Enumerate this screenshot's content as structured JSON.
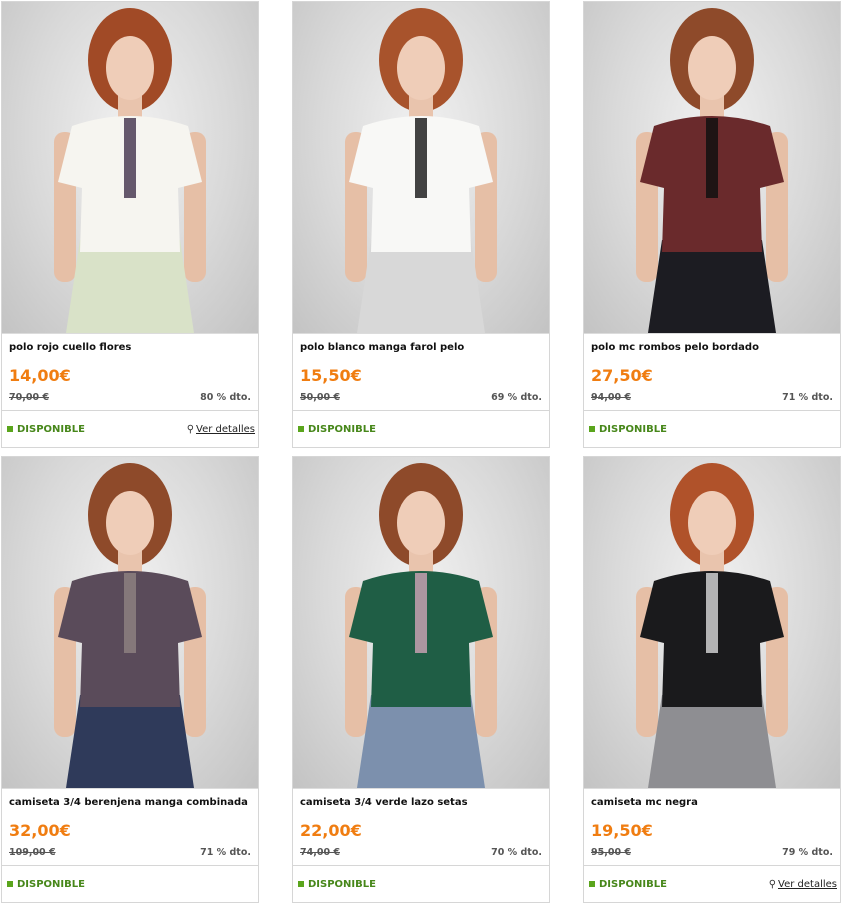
{
  "products": [
    {
      "name": "polo rojo cuello flores",
      "price": "14,00€",
      "old_price": "70,00 €",
      "discount": "80 % dto.",
      "availability": "DISPONIBLE",
      "details_label": "Ver detalles",
      "colors": {
        "top": "#f6f5f0",
        "bottom": "#d9e2c8",
        "hair": "#a14a26",
        "accent": "#4b3c55"
      }
    },
    {
      "name": "polo blanco manga farol pelo",
      "price": "15,50€",
      "old_price": "50,00 €",
      "discount": "69 % dto.",
      "availability": "DISPONIBLE",
      "colors": {
        "top": "#f8f8f6",
        "bottom": "#d8d8d8",
        "hair": "#a8532c",
        "accent": "#222222"
      }
    },
    {
      "name": "polo mc rombos pelo bordado",
      "price": "27,50€",
      "old_price": "94,00 €",
      "discount": "71 % dto.",
      "availability": "DISPONIBLE",
      "colors": {
        "top": "#6a2a2c",
        "bottom": "#1c1c22",
        "hair": "#8e4a2a",
        "accent": "#111111"
      }
    },
    {
      "name": "camiseta 3/4 berenjena manga combinada",
      "price": "32,00€",
      "old_price": "109,00 €",
      "discount": "71 % dto.",
      "availability": "DISPONIBLE",
      "colors": {
        "top": "#5a4b5a",
        "bottom": "#2f3a5a",
        "hair": "#8e4a2a",
        "accent": "#8d8080"
      }
    },
    {
      "name": "camiseta 3/4 verde lazo setas",
      "price": "22,00€",
      "old_price": "74,00 €",
      "discount": "70 % dto.",
      "availability": "DISPONIBLE",
      "colors": {
        "top": "#1f5e45",
        "bottom": "#7c90ad",
        "hair": "#8e4a2a",
        "accent": "#c6a0b0"
      }
    },
    {
      "name": "camiseta mc negra",
      "price": "19,50€",
      "old_price": "95,00 €",
      "discount": "79 % dto.",
      "availability": "DISPONIBLE",
      "details_label": "Ver detalles",
      "colors": {
        "top": "#1a1a1c",
        "bottom": "#8e8e92",
        "hair": "#b0522a",
        "accent": "#cfcfcf"
      }
    }
  ]
}
